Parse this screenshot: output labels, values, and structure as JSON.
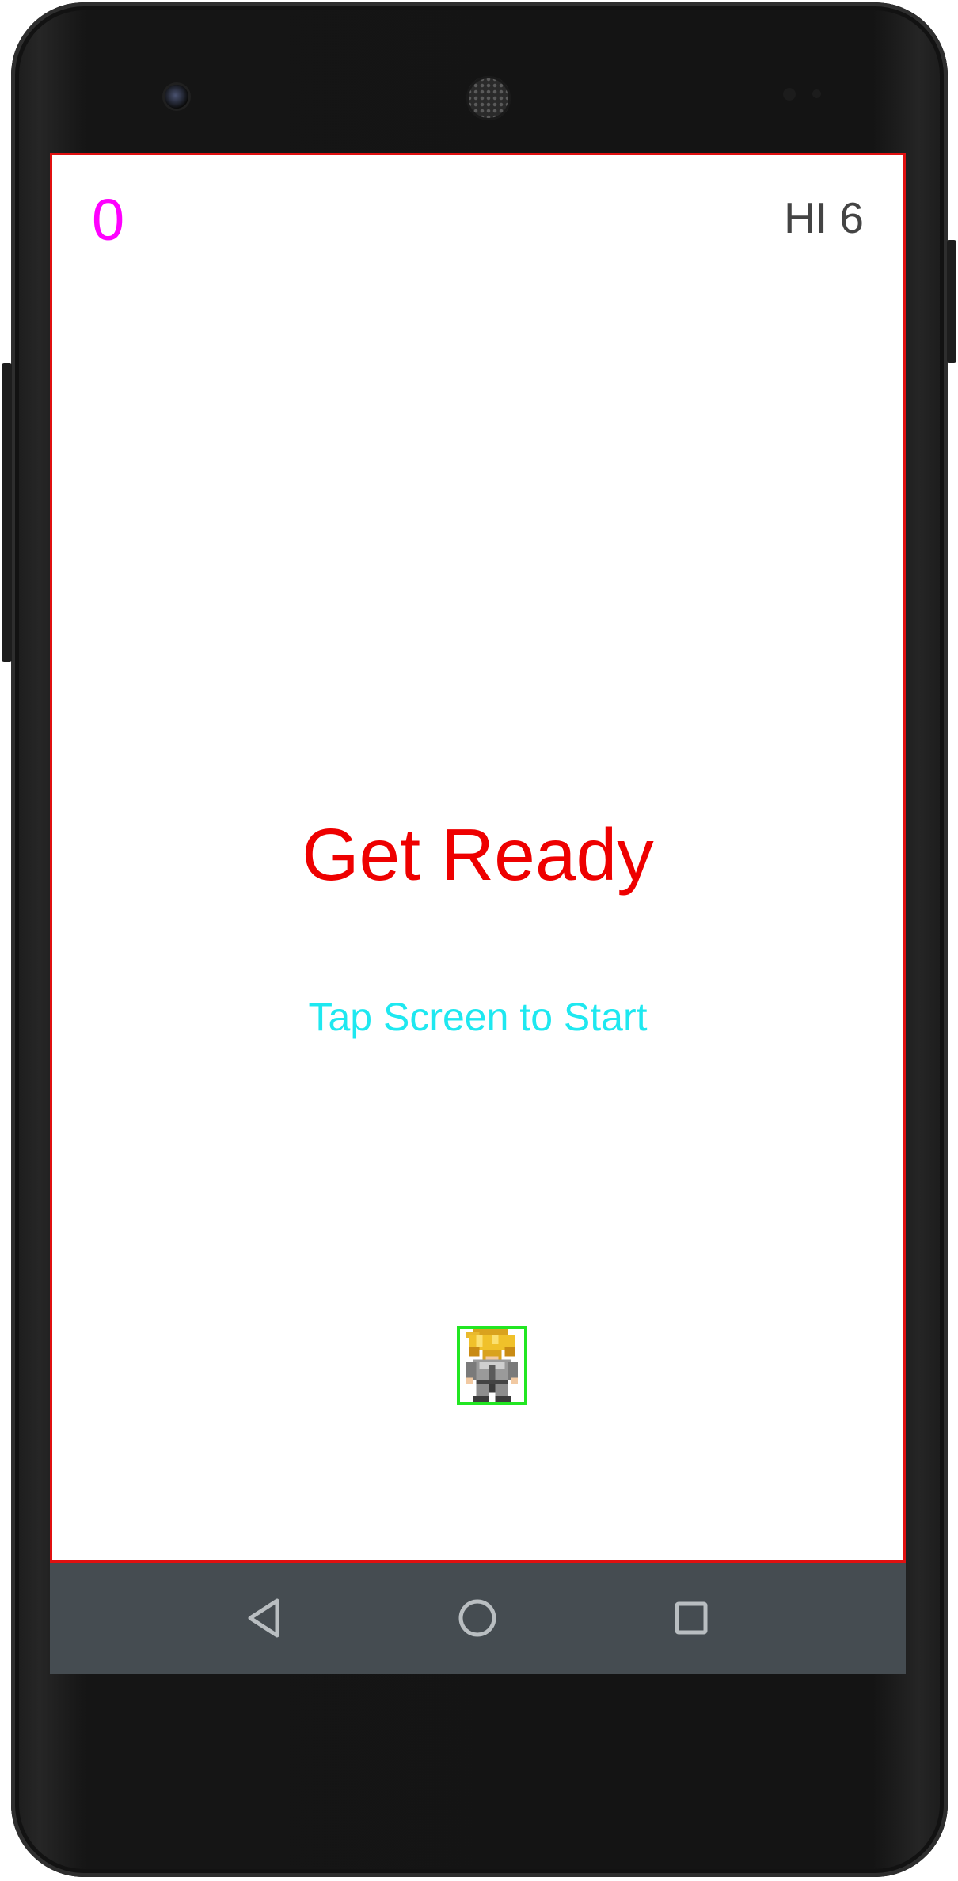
{
  "game": {
    "score": "0",
    "high_score": "HI 6",
    "title": "Get Ready",
    "prompt": "Tap Screen to Start"
  },
  "player": {
    "sprite": "blonde-armored-hero-sprite"
  },
  "navigation_bar": {
    "buttons": [
      "back-icon",
      "home-icon",
      "recents-icon"
    ]
  },
  "colors": {
    "score": "#ff00ff",
    "high_score": "#444444",
    "title": "#ee0000",
    "prompt": "#1ee8f0",
    "screen_border": "#e01010",
    "player_hitbox": "#22e622",
    "navigation_bar": "#454c51",
    "nav_icons": "#b9bec1"
  }
}
